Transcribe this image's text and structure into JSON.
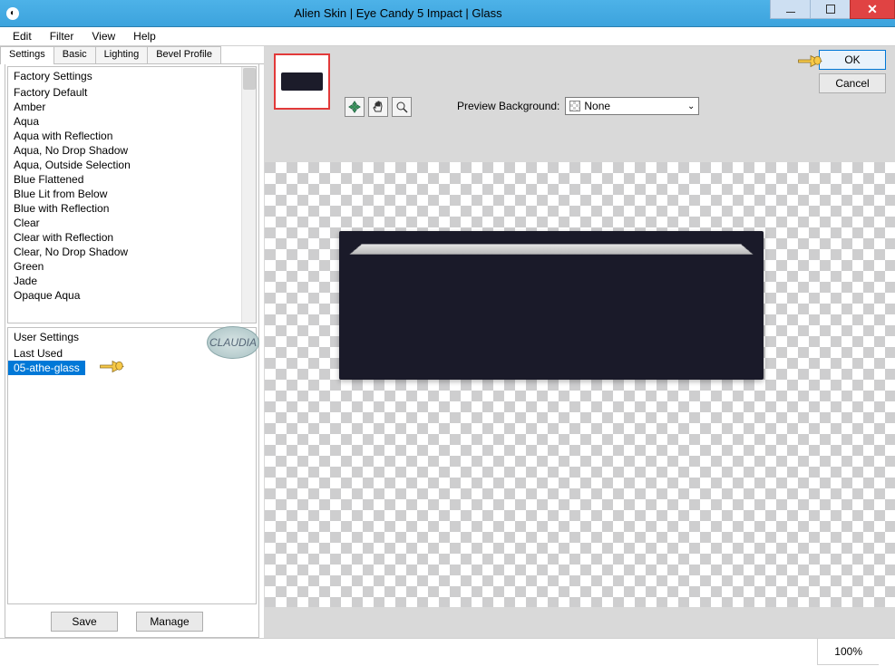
{
  "window": {
    "title": "Alien Skin | Eye Candy 5 Impact | Glass"
  },
  "menubar": {
    "edit": "Edit",
    "filter": "Filter",
    "view": "View",
    "help": "Help"
  },
  "tabs": {
    "settings": "Settings",
    "basic": "Basic",
    "lighting": "Lighting",
    "bevel": "Bevel Profile"
  },
  "factory": {
    "header": "Factory Settings",
    "items": [
      "Factory Default",
      "Amber",
      "Aqua",
      "Aqua with Reflection",
      "Aqua, No Drop Shadow",
      "Aqua, Outside Selection",
      "Blue Flattened",
      "Blue Lit from Below",
      "Blue with Reflection",
      "Clear",
      "Clear with Reflection",
      "Clear, No Drop Shadow",
      "Green",
      "Jade",
      "Opaque Aqua"
    ]
  },
  "user": {
    "header": "User Settings",
    "items": {
      "last_used": "Last Used",
      "selected": "05-athe-glass"
    }
  },
  "buttons": {
    "save": "Save",
    "manage": "Manage",
    "ok": "OK",
    "cancel": "Cancel"
  },
  "preview": {
    "bg_label": "Preview Background:",
    "bg_value": "None"
  },
  "status": {
    "zoom": "100%"
  },
  "badge_text": "CLAUDIA"
}
